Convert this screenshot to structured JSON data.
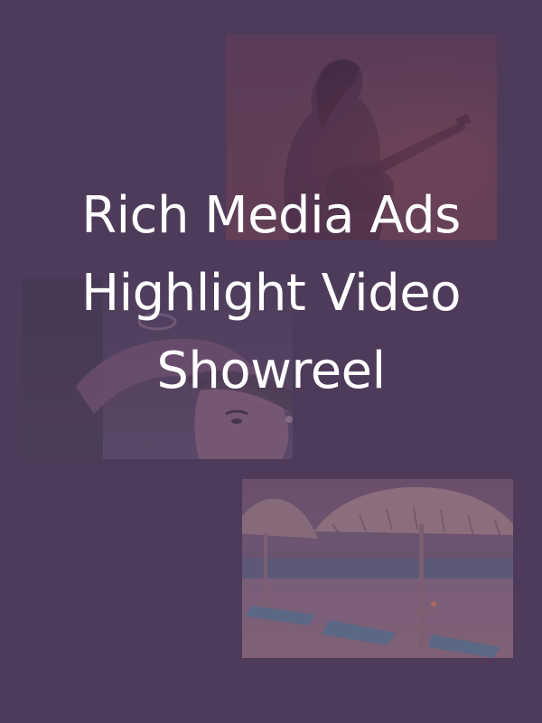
{
  "page": {
    "background_color": "#4e3a59",
    "text_color": "#ffffff"
  },
  "headline": {
    "lines": [
      "Rich Media Ads",
      "Highlight Video",
      "Showreel"
    ]
  },
  "tiles": [
    {
      "subject": "guitarist-silhouette"
    },
    {
      "subject": "woman-portrait"
    },
    {
      "subject": "beach-umbrellas"
    }
  ]
}
